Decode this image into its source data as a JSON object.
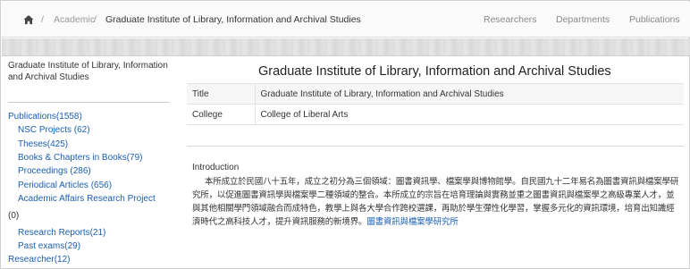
{
  "breadcrumb": {
    "separator": "/",
    "academic": "Academic",
    "current": "Graduate Institute of Library, Information and Archival Studies"
  },
  "nav": {
    "researchers": "Researchers",
    "departments": "Departments",
    "publications": "Publications"
  },
  "sidebar": {
    "title": "Graduate Institute of Library, Information and Archival Studies",
    "publications": "Publications(1558)",
    "items": [
      "NSC Projects (62)",
      "Theses(425)",
      "Books & Chapters in Books(79)",
      "Proceedings (286)",
      "Periodical Articles (656)",
      "Academic Affairs Research Project"
    ],
    "academic_count": "(0)",
    "items2": [
      "Research Reports(21)",
      "Past exams(29)"
    ],
    "researcher": "Researcher(12)"
  },
  "main": {
    "title": "Graduate Institute of Library, Information and Archival Studies",
    "rows": [
      {
        "key": "Title",
        "value": "Graduate Institute of Library, Information and Archival Studies"
      },
      {
        "key": "College",
        "value": "College of Liberal Arts"
      }
    ],
    "intro_heading": "Introduction",
    "intro_text": "本所成立於民國八十五年，成立之初分為三個領域：圖書資訊學、檔案學與博物館學。自民國九十二年易名為圖書資訊與檔案學研究所，以促進圖書資訊學與檔案學二種領域的整合。本所成立的宗旨在培育理論與實務並重之圖書資訊與檔案學之高級專業人才，並與其他相關學門領域融合而成特色，教學上與各大學合作跨校選課，再助於學生彈性化學習，掌握多元化的資訊環境，培育出知識經濟時代之高科技人才，提升資訊服務的新境界。",
    "intro_link": "圖書資訊與檔案學研究所"
  },
  "colors": {
    "link": "#1a5fb4",
    "text": "#333333",
    "muted": "#888888"
  }
}
